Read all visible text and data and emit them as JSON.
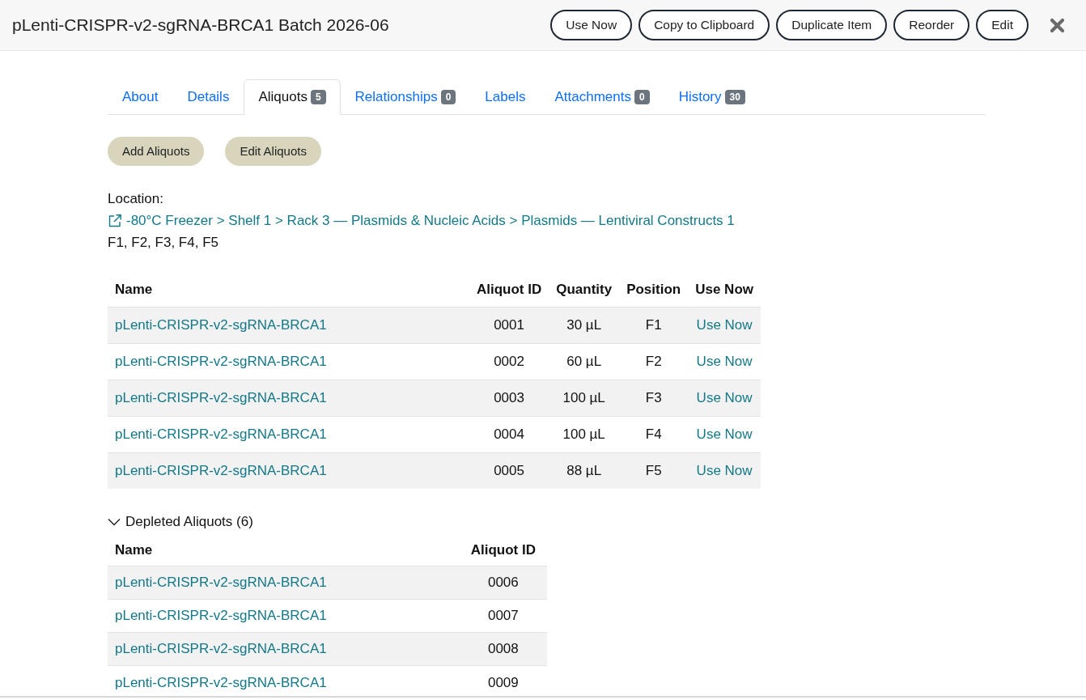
{
  "header": {
    "title": "pLenti-CRISPR-v2-sgRNA-BRCA1 Batch 2026-06",
    "actions": [
      "Use Now",
      "Copy to Clipboard",
      "Duplicate Item",
      "Reorder",
      "Edit"
    ]
  },
  "tabs": [
    {
      "label": "About",
      "selected": false
    },
    {
      "label": "Details",
      "selected": false
    },
    {
      "label": "Aliquots",
      "badge": "5",
      "selected": true
    },
    {
      "label": "Relationships",
      "badge": "0",
      "selected": false
    },
    {
      "label": "Labels",
      "selected": false
    },
    {
      "label": "Attachments",
      "badge": "0",
      "selected": false
    },
    {
      "label": "History",
      "badge": "30",
      "selected": false
    }
  ],
  "aliquot_actions": [
    "Add Aliquots",
    "Edit Aliquots"
  ],
  "location": {
    "label": "Location:",
    "path": "-80°C Freezer > Shelf 1 > Rack 3 — Plasmids & Nucleic Acids > Plasmids — Lentiviral Constructs 1",
    "positions": "F1, F2, F3, F4, F5"
  },
  "aliquots_table": {
    "columns": [
      "Name",
      "Aliquot ID",
      "Quantity",
      "Position",
      "Use Now"
    ],
    "rows": [
      {
        "name": "pLenti-CRISPR-v2-sgRNA-BRCA1",
        "aliquot_id": "0001",
        "quantity": "30 µL",
        "position": "F1",
        "action": "Use Now"
      },
      {
        "name": "pLenti-CRISPR-v2-sgRNA-BRCA1",
        "aliquot_id": "0002",
        "quantity": "60 µL",
        "position": "F2",
        "action": "Use Now"
      },
      {
        "name": "pLenti-CRISPR-v2-sgRNA-BRCA1",
        "aliquot_id": "0003",
        "quantity": "100 µL",
        "position": "F3",
        "action": "Use Now"
      },
      {
        "name": "pLenti-CRISPR-v2-sgRNA-BRCA1",
        "aliquot_id": "0004",
        "quantity": "100 µL",
        "position": "F4",
        "action": "Use Now"
      },
      {
        "name": "pLenti-CRISPR-v2-sgRNA-BRCA1",
        "aliquot_id": "0005",
        "quantity": "88 µL",
        "position": "F5",
        "action": "Use Now"
      }
    ]
  },
  "depleted": {
    "label": "Depleted Aliquots (6)",
    "expanded": true,
    "columns": [
      "Name",
      "Aliquot ID"
    ],
    "rows": [
      {
        "name": "pLenti-CRISPR-v2-sgRNA-BRCA1",
        "aliquot_id": "0006"
      },
      {
        "name": "pLenti-CRISPR-v2-sgRNA-BRCA1",
        "aliquot_id": "0007"
      },
      {
        "name": "pLenti-CRISPR-v2-sgRNA-BRCA1",
        "aliquot_id": "0008"
      },
      {
        "name": "pLenti-CRISPR-v2-sgRNA-BRCA1",
        "aliquot_id": "0009"
      }
    ]
  }
}
